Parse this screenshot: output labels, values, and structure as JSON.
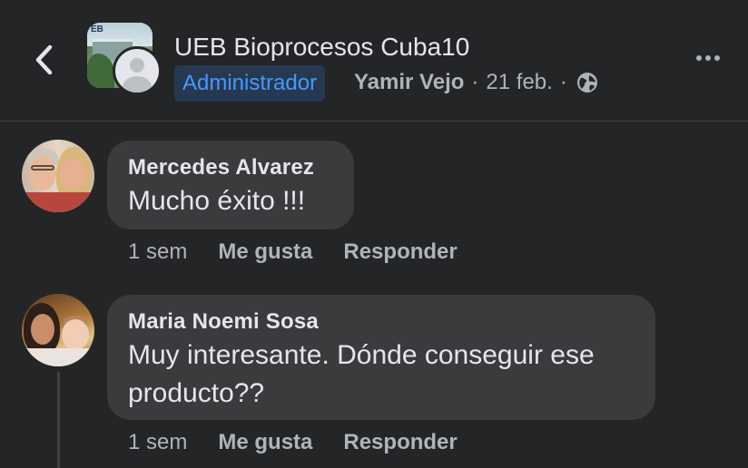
{
  "header": {
    "group_name": "UEB Bioprocesos Cuba10",
    "role_badge": "Administrador",
    "author": "Yamir Vejo",
    "separator": "·",
    "date": "21 feb.",
    "group_avatar_text": "EB",
    "back_icon": "chevron-left-icon",
    "privacy_icon": "globe-icon",
    "more_icon": "more-horizontal-icon"
  },
  "comments": [
    {
      "name": "Mercedes Alvarez",
      "text": "Mucho éxito !!!",
      "time": "1 sem",
      "like_label": "Me gusta",
      "reply_label": "Responder"
    },
    {
      "name": "Maria Noemi Sosa",
      "text": "Muy interesante. Dónde conseguir ese producto??",
      "time": "1 sem",
      "like_label": "Me gusta",
      "reply_label": "Responder"
    }
  ],
  "colors": {
    "background": "#242526",
    "bubble": "#3a3b3c",
    "primary_text": "#e4e6eb",
    "secondary_text": "#b0b3b8",
    "badge_bg": "#263951",
    "badge_text": "#4599ff"
  }
}
